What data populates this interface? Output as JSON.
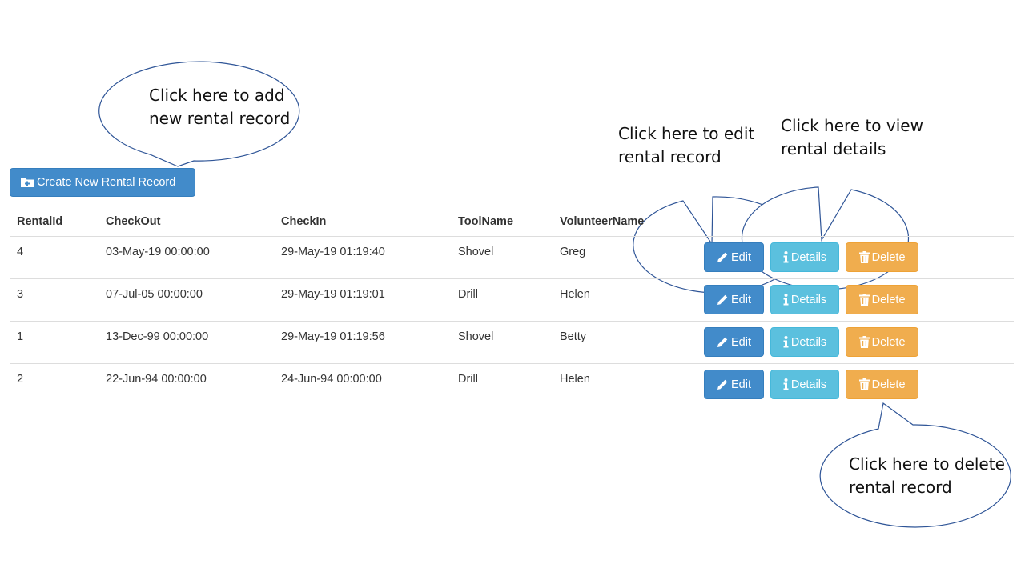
{
  "create_button": {
    "label": "Create New Rental Record",
    "icon": "folder-plus-icon"
  },
  "table": {
    "headers": [
      "RentalId",
      "CheckOut",
      "CheckIn",
      "ToolName",
      "VolunteerName"
    ],
    "rows": [
      {
        "id": "4",
        "checkout": "03-May-19 00:00:00",
        "checkin": "29-May-19 01:19:40",
        "tool": "Shovel",
        "volunteer": "Greg"
      },
      {
        "id": "3",
        "checkout": "07-Jul-05 00:00:00",
        "checkin": "29-May-19 01:19:01",
        "tool": "Drill",
        "volunteer": "Helen"
      },
      {
        "id": "1",
        "checkout": "13-Dec-99 00:00:00",
        "checkin": "29-May-19 01:19:56",
        "tool": "Shovel",
        "volunteer": "Betty"
      },
      {
        "id": "2",
        "checkout": "22-Jun-94 00:00:00",
        "checkin": "24-Jun-94 00:00:00",
        "tool": "Drill",
        "volunteer": "Helen"
      }
    ],
    "actions": {
      "edit": "Edit",
      "details": "Details",
      "delete": "Delete"
    }
  },
  "callouts": {
    "add": [
      "Click here to add",
      "new rental record"
    ],
    "edit": [
      "Click here to edit",
      "rental record"
    ],
    "view": [
      "Click here to view",
      "rental details"
    ],
    "delete": [
      "Click here to delete",
      "rental record"
    ]
  },
  "colors": {
    "primary": "#428bca",
    "info": "#5bc0de",
    "warning": "#f0ad4e",
    "callout_stroke": "#2f5597"
  }
}
